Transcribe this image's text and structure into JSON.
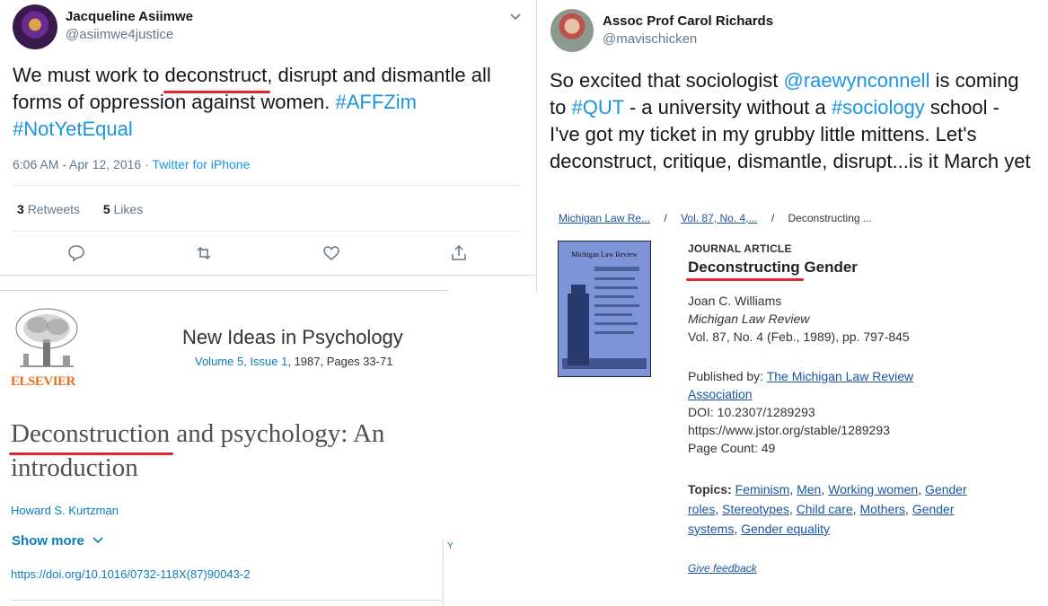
{
  "tweet1": {
    "name": "Jacqueline Asiimwe",
    "handle": "@asiimwe4justice",
    "text_line1_pre": "We must work to ",
    "text_highlight": "deconstruct",
    "text_line1_post": ", disrupt and dismantle all",
    "text_line2_pre": "forms of oppression against women. ",
    "hashtag1": "#AFFZim",
    "hashtag2": "#NotYetEqual",
    "timestamp": "6:06 AM - Apr 12, 2016",
    "source": "Twitter for iPhone",
    "retweets_count": "3",
    "retweets_label": "Retweets",
    "likes_count": "5",
    "likes_label": "Likes"
  },
  "tweet2": {
    "name": "Assoc Prof Carol Richards",
    "handle": "@mavischicken",
    "line1_pre": "So excited that sociologist ",
    "mention": "@raewynconnell",
    "line1_post": " is coming",
    "line2_pre": "to ",
    "hashtag_qut": "#QUT",
    "line2_mid": " - a university without a ",
    "hashtag_soc": "#sociology",
    "line2_post": " school -",
    "line3": "I've got my ticket in my grubby little mittens. Let's",
    "highlight": "deconstruct,",
    "line4_post": " critique, dismantle, disrupt...is it March yet"
  },
  "article": {
    "journal": "New Ideas in Psychology",
    "volume_issue": "Volume 5, Issue 1",
    "year_pages": ", 1987, Pages 33-71",
    "publisher_logo": "ELSEVIER",
    "title_highlight": "Deconstruction",
    "title_rest1": " and psychology: An",
    "title_line2": "introduction",
    "author": "Howard S. Kurtzman",
    "show_more": "Show more",
    "doi": "https://doi.org/10.1016/0732-118X(87)90043-2",
    "edge_char": "Y"
  },
  "jstor": {
    "breadcrumb1": "Michigan Law Re...",
    "breadcrumb_sep": "/",
    "breadcrumb2": "Vol. 87, No. 4,...",
    "breadcrumb3": "Deconstructing ...",
    "type_label": "JOURNAL ARTICLE",
    "title_highlight": "Deconstructing",
    "title_rest": " Gender",
    "author": "Joan C. Williams",
    "journal": "Michigan Law Review",
    "volume": "Vol. 87, No. 4 (Feb., 1989), pp. 797-845",
    "published_by_label": "Published by: ",
    "publisher_line1": "The Michigan Law Review",
    "publisher_line2": "Association",
    "doi": "DOI: 10.2307/1289293",
    "stable_url": "https://www.jstor.org/stable/1289293",
    "page_count": "Page Count: 49",
    "topics_label": "Topics:",
    "topics": [
      "Feminism",
      "Men",
      "Working women",
      "Gender roles",
      "Stereotypes",
      "Child care",
      "Mothers",
      "Gender systems",
      "Gender equality"
    ],
    "cover_title": "Michigan Law Review",
    "give_feedback": "Give feedback"
  }
}
